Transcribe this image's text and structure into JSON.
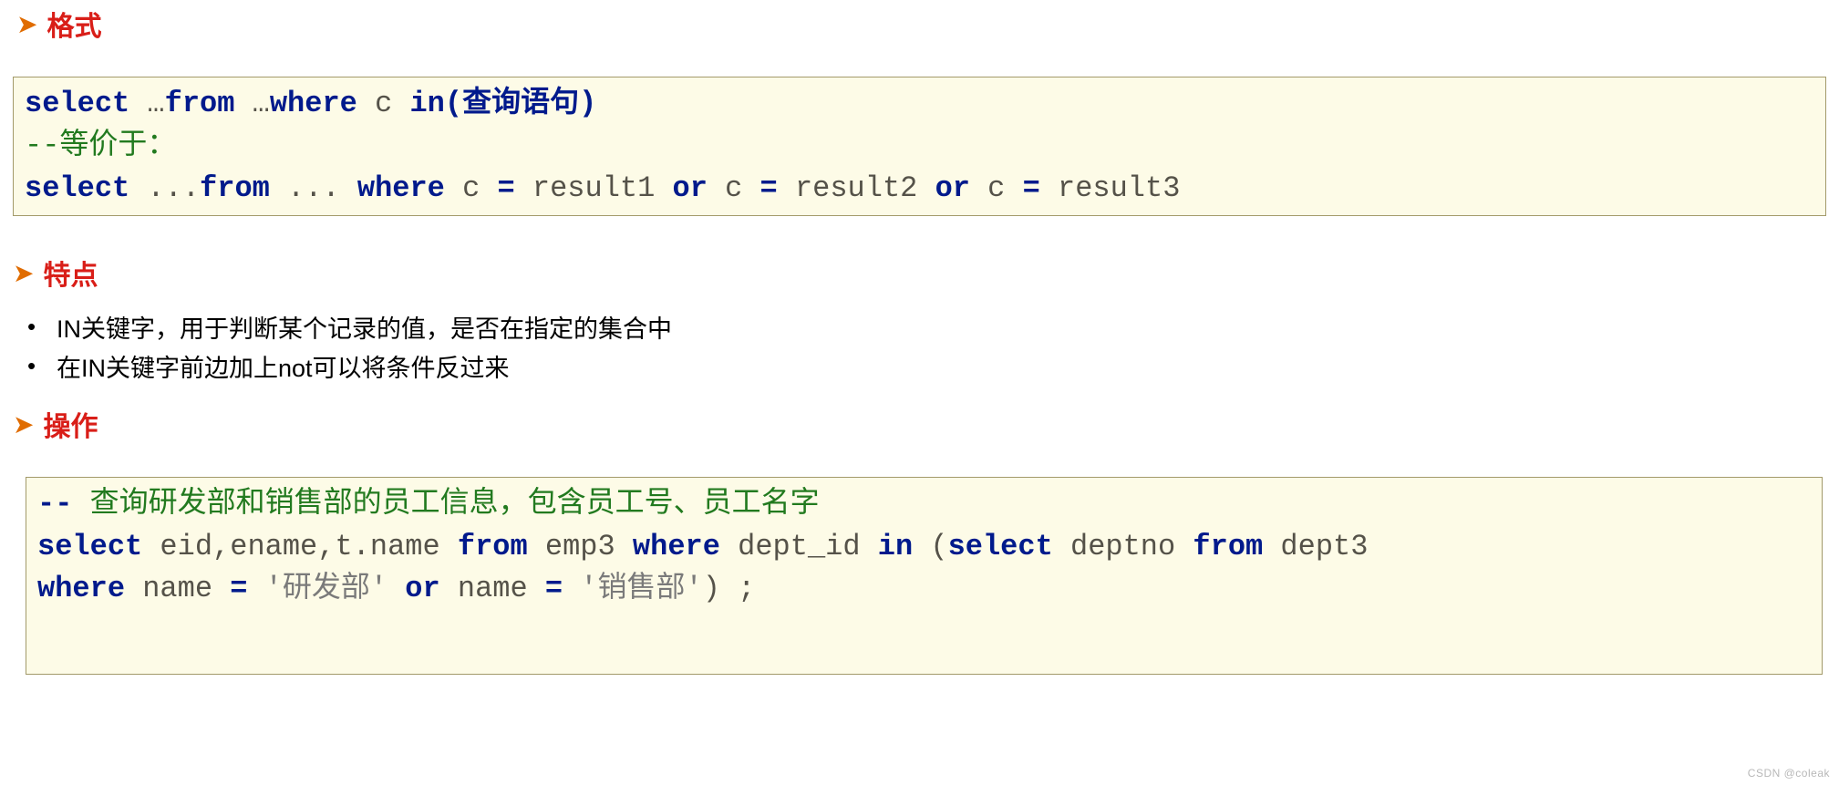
{
  "s1": {
    "title": "格式"
  },
  "code1": {
    "l1": {
      "a": "select",
      "b": " …",
      "c": "from",
      "d": " …",
      "e": "where",
      "f": " c ",
      "g": "in(查询语句)"
    },
    "l2": "--等价于：",
    "l3": {
      "a": "select",
      "b": " ...",
      "c": "from",
      "d": " ... ",
      "e": "where",
      "f": " c ",
      "g": "=",
      "h": " result1 ",
      "i": "or",
      "j": " c ",
      "k": "=",
      "l": " result2 ",
      "m": "or",
      "n": " c ",
      "o": "=",
      "p": " result3"
    }
  },
  "s2": {
    "title": "特点",
    "b1": "IN关键字，用于判断某个记录的值，是否在指定的集合中",
    "b2": "在IN关键字前边加上not可以将条件反过来"
  },
  "s3": {
    "title": "操作"
  },
  "code2": {
    "l1": {
      "a": "--",
      "b": " 查询研发部和销售部的员工信息，包含员工号、员工名字"
    },
    "l2": {
      "a": "select",
      "b": " eid,ename,t.name ",
      "c": "from",
      "d": " emp3 ",
      "e": "where",
      "f": " dept_id ",
      "g": "in",
      "h": " (",
      "i": "select",
      "j": " deptno ",
      "k": "from",
      "l": " dept3"
    },
    "l3": {
      "a": "where",
      "b": " name ",
      "c": "=",
      "d": " '研发部' ",
      "e": "or",
      "f": " name ",
      "g": "=",
      "h": " '销售部'",
      "i": ") ;"
    }
  },
  "watermark": "CSDN @coleak"
}
